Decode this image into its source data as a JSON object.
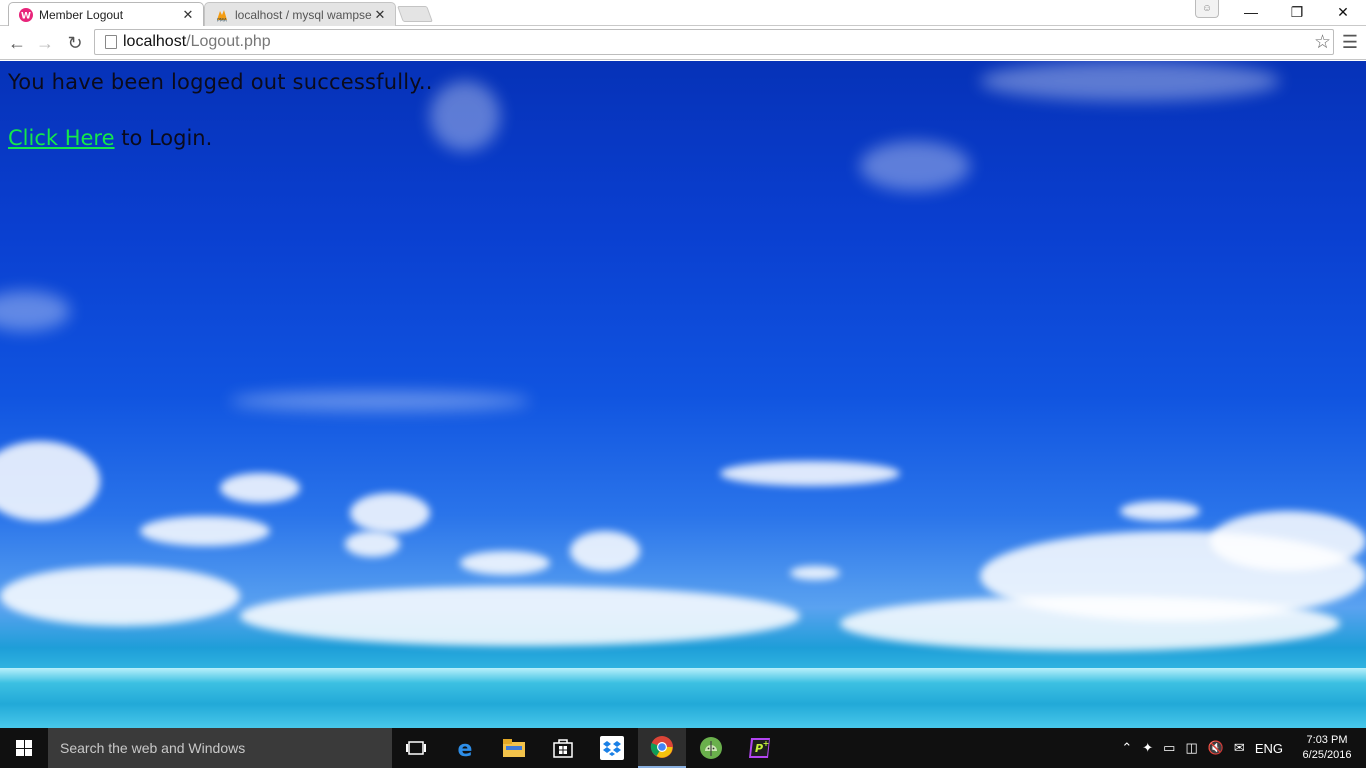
{
  "browser": {
    "tabs": [
      {
        "title": "Member Logout",
        "favicon": "wamp-icon"
      },
      {
        "title": "localhost / mysql wampse",
        "favicon": "phpmyadmin-icon"
      }
    ],
    "tab_close_glyph": "✕",
    "url_host": "localhost",
    "url_path": "/Logout.php"
  },
  "page": {
    "message": "You have been logged out successfully..",
    "link_text": "Click Here",
    "after_link_text": " to Login."
  },
  "taskbar": {
    "search_placeholder": "Search the web and Windows",
    "tray_language": "ENG",
    "time": "7:03 PM",
    "date": "6/25/2016",
    "apps": [
      "task-view-icon",
      "edge-icon",
      "file-explorer-icon",
      "store-icon",
      "dropbox-icon",
      "chrome-icon",
      "android-studio-icon",
      "phpstorm-icon"
    ]
  },
  "colors": {
    "sky_top": "#0632b8",
    "link": "#14e84a",
    "taskbar": "#101010"
  }
}
